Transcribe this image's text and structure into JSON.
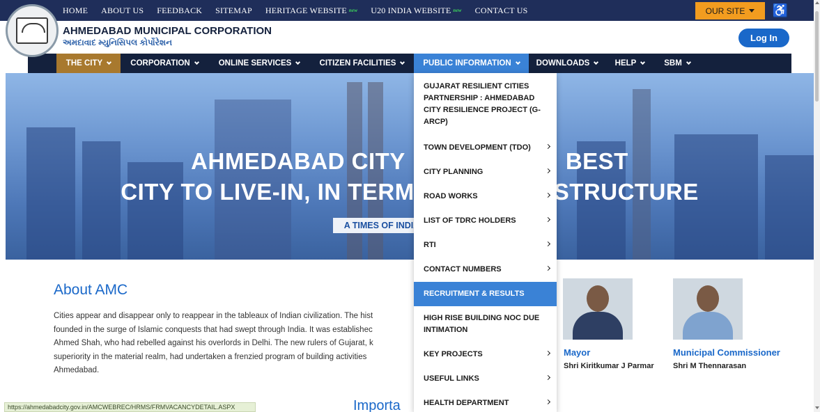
{
  "topbar": {
    "links": [
      {
        "label": "HOME"
      },
      {
        "label": "ABOUT US"
      },
      {
        "label": "FEEDBACK"
      },
      {
        "label": "SITEMAP"
      },
      {
        "label": "HERITAGE WEBSITE",
        "tag": "new"
      },
      {
        "label": "U20 INDIA WEBSITE",
        "tag": "new"
      },
      {
        "label": "CONTACT US"
      }
    ],
    "our_site": "OUR SITE",
    "accessibility_icon": "wheelchair-icon",
    "accent_color": "#f29c1f"
  },
  "header": {
    "org_name_en": "AHMEDABAD MUNICIPAL CORPORATION",
    "org_name_gu": "અમદાવાદ મ્યુનિસિપલ કોર્પોરેશન",
    "login_label": "Log In",
    "login_color": "#1a68c9"
  },
  "nav": {
    "items": [
      {
        "label": "THE CITY"
      },
      {
        "label": "CORPORATION"
      },
      {
        "label": "ONLINE SERVICES"
      },
      {
        "label": "CITIZEN FACILITIES"
      },
      {
        "label": "PUBLIC INFORMATION"
      },
      {
        "label": "DOWNLOADS"
      },
      {
        "label": "HELP"
      },
      {
        "label": "SBM"
      }
    ],
    "active_color": "#a8792e",
    "open_color": "#3a82d6"
  },
  "hero": {
    "line1": "AHMEDABAD CITY",
    "line1_right": "BEST",
    "line2_left": "CITY TO LIVE-IN, IN TERM",
    "line2_right": "STRUCTURE",
    "pill": "A TIMES OF INDIA"
  },
  "dropdown": {
    "items": [
      {
        "label": "GUJARAT RESILIENT CITIES PARTNERSHIP : AHMEDABAD CITY RESILIENCE PROJECT (G-ARCP)",
        "has_sub": false
      },
      {
        "label": "TOWN DEVELOPMENT (TDO)",
        "has_sub": true
      },
      {
        "label": "CITY PLANNING",
        "has_sub": true
      },
      {
        "label": "ROAD WORKS",
        "has_sub": true
      },
      {
        "label": "LIST OF TDRC HOLDERS",
        "has_sub": true
      },
      {
        "label": "RTI",
        "has_sub": true
      },
      {
        "label": "CONTACT NUMBERS",
        "has_sub": true
      },
      {
        "label": "RECRUITMENT & RESULTS",
        "has_sub": false,
        "active": true
      },
      {
        "label": "HIGH RISE BUILDING NOC DUE INTIMATION",
        "has_sub": false
      },
      {
        "label": "KEY PROJECTS",
        "has_sub": true
      },
      {
        "label": "USEFUL LINKS",
        "has_sub": true
      },
      {
        "label": "HEALTH DEPARTMENT",
        "has_sub": true
      }
    ]
  },
  "about": {
    "title": "About AMC",
    "lines": [
      "Cities appear and disappear only to reappear in the tableaux of Indian civilization. The hist",
      "founded in the surge of Islamic conquests that had swept through India. It was establishec",
      "Ahmed Shah, who had rebelled against his overlords in Delhi. The new rulers of Gujarat, k",
      "superiority in the material realm, had undertaken a frenzied program of building activities",
      "Ahmedabad."
    ]
  },
  "officials": [
    {
      "role": "Mayor",
      "name": "Shri Kiritkumar J Parmar"
    },
    {
      "role": "Municipal Commissioner",
      "name": "Shri M Thennarasan"
    }
  ],
  "important_heading": "Importa",
  "status_url": "https://ahmedabadcity.gov.in/AMCWEBREC/HRMS/FRMVACANCYDETAIL.ASPX"
}
